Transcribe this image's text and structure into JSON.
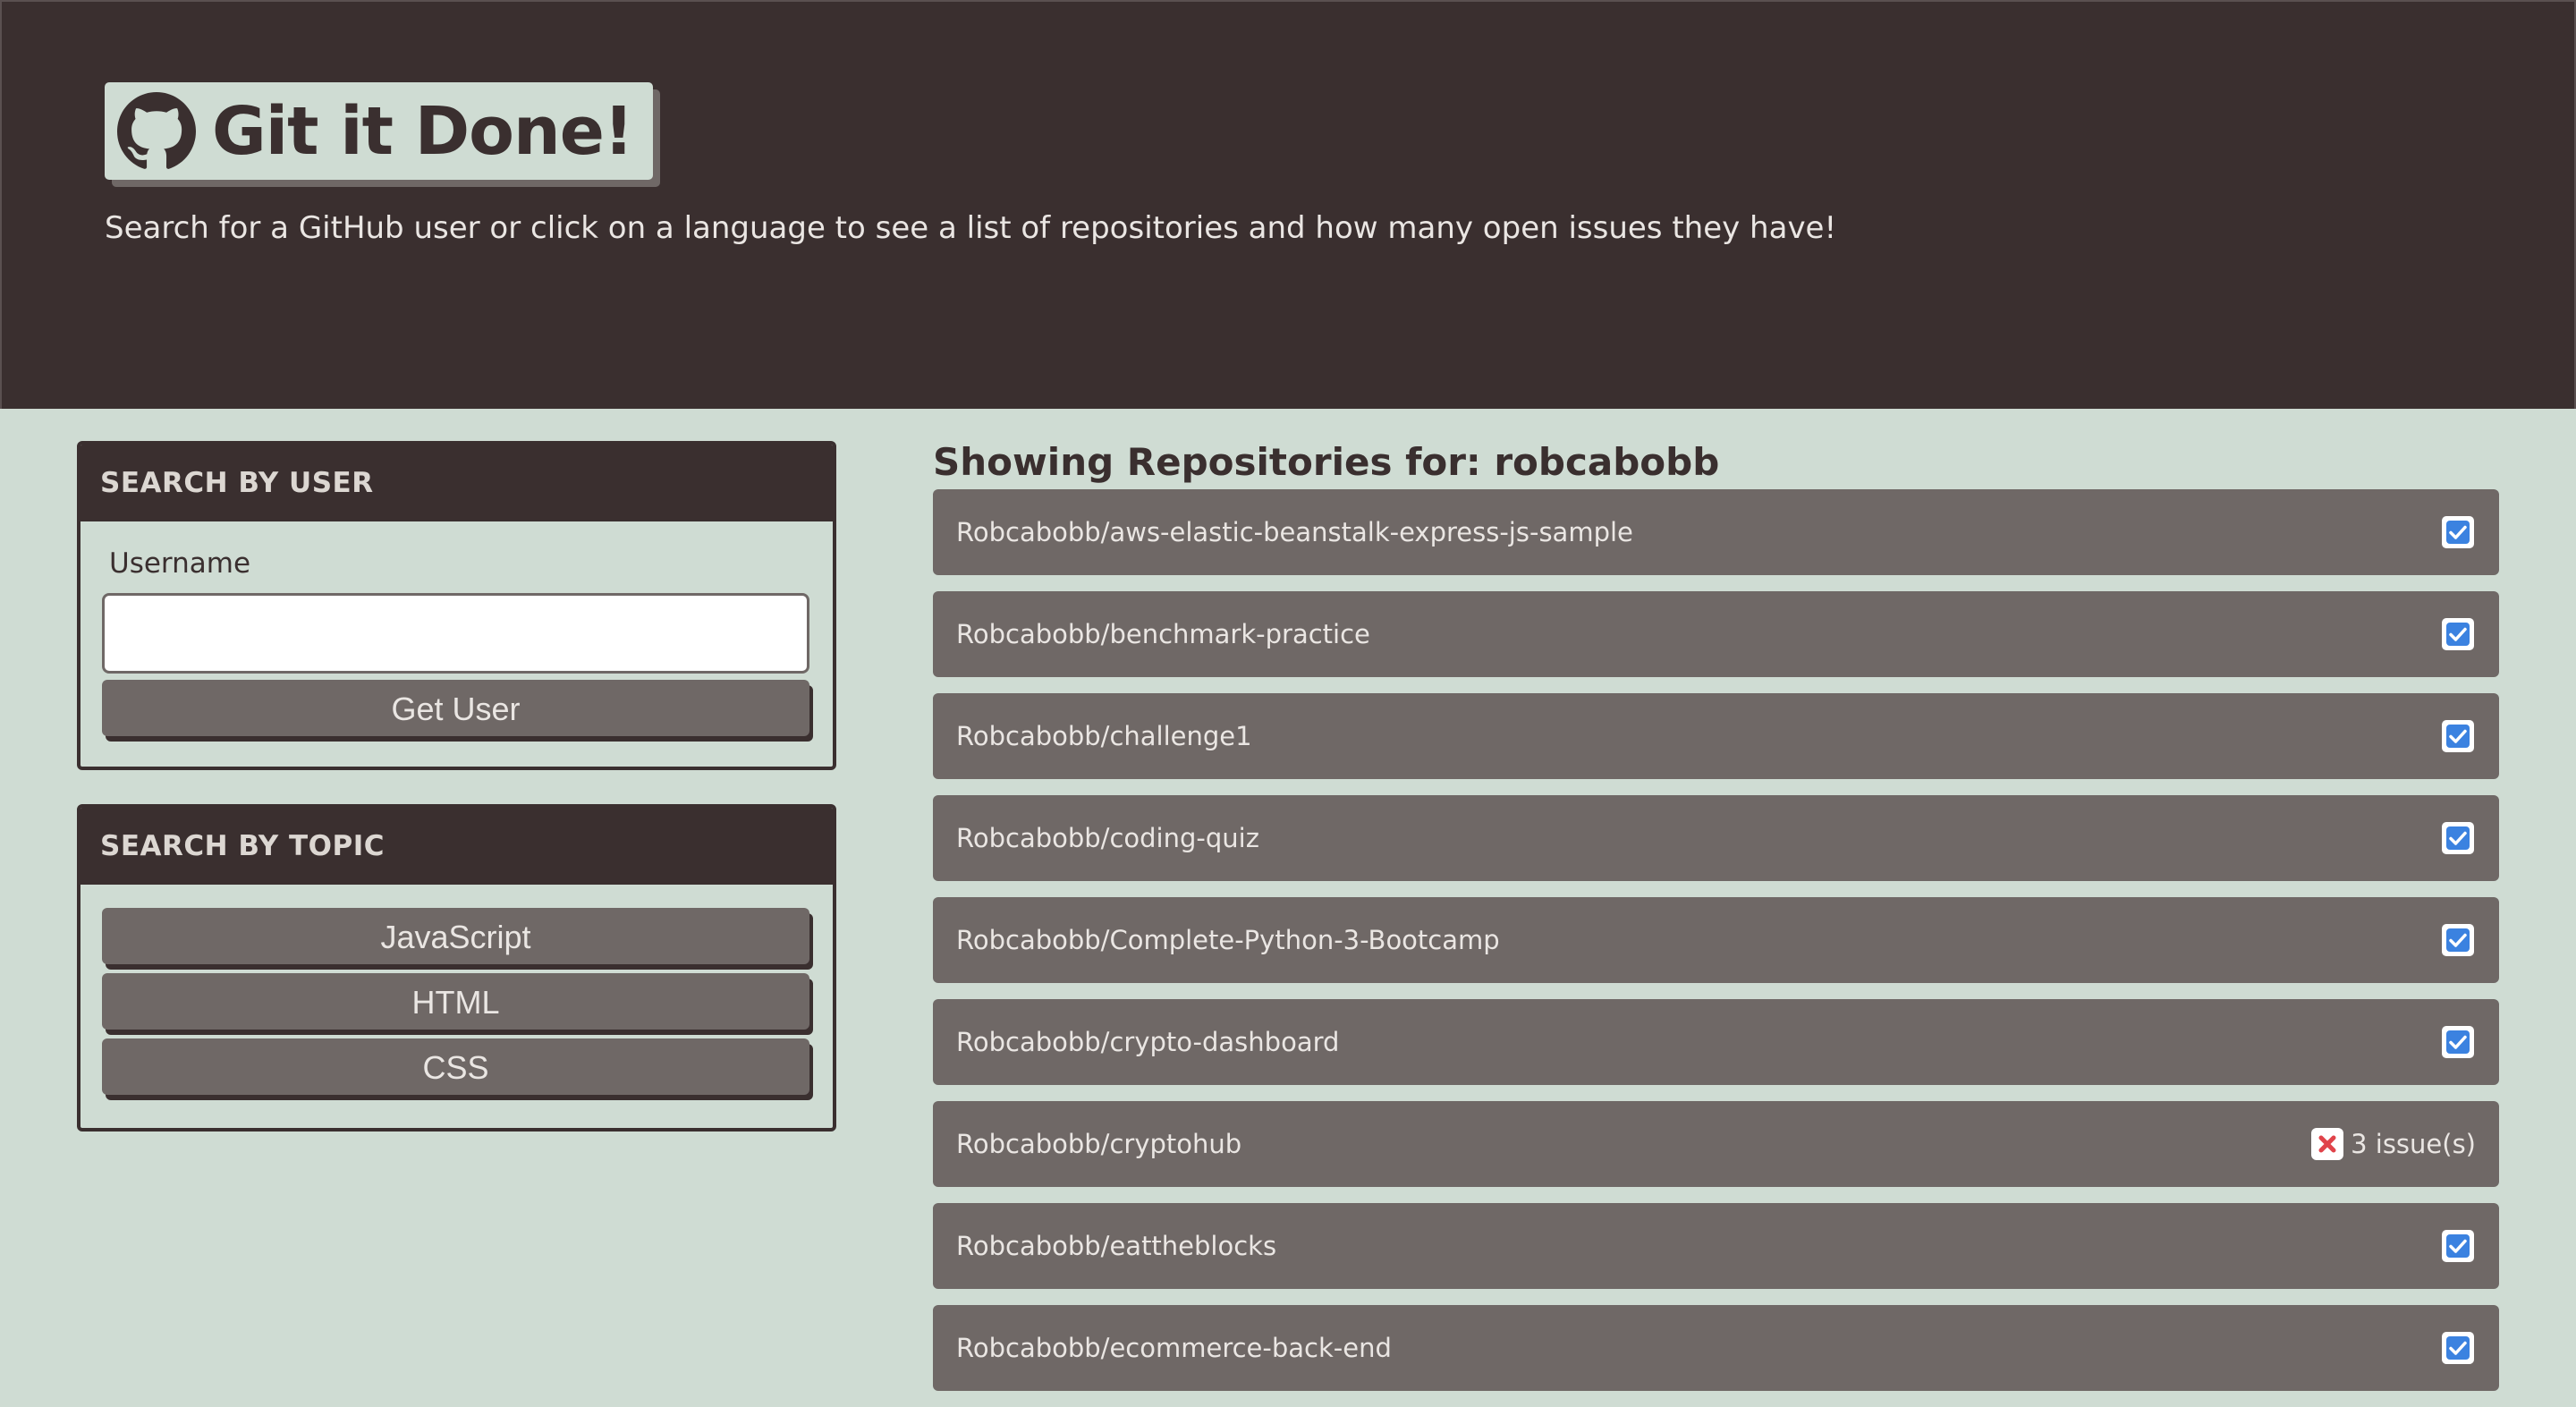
{
  "header": {
    "title": "Git it Done!",
    "logo_icon": "github-octocat-icon",
    "tagline": "Search for a GitHub user or click on a language to see a list of repositories and how many open issues they have!"
  },
  "search_user": {
    "heading": "SEARCH BY USER",
    "field_label": "Username",
    "input_value": "",
    "button_label": "Get User"
  },
  "search_topic": {
    "heading": "SEARCH BY TOPIC",
    "topics": [
      "JavaScript",
      "HTML",
      "CSS"
    ]
  },
  "repos": {
    "title": "Showing Repositories for: robcabobb",
    "items": [
      {
        "name": "Robcabobb/aws-elastic-beanstalk-express-js-sample",
        "status": "check-icon",
        "issues": ""
      },
      {
        "name": "Robcabobb/benchmark-practice",
        "status": "check-icon",
        "issues": ""
      },
      {
        "name": "Robcabobb/challenge1",
        "status": "check-icon",
        "issues": ""
      },
      {
        "name": "Robcabobb/coding-quiz",
        "status": "check-icon",
        "issues": ""
      },
      {
        "name": "Robcabobb/Complete-Python-3-Bootcamp",
        "status": "check-icon",
        "issues": ""
      },
      {
        "name": "Robcabobb/crypto-dashboard",
        "status": "check-icon",
        "issues": ""
      },
      {
        "name": "Robcabobb/cryptohub",
        "status": "x-icon",
        "issues": "3 issue(s)"
      },
      {
        "name": "Robcabobb/eattheblocks",
        "status": "check-icon",
        "issues": ""
      },
      {
        "name": "Robcabobb/ecommerce-back-end",
        "status": "check-icon",
        "issues": ""
      }
    ]
  },
  "colors": {
    "header_bg": "#3a2f2f",
    "page_bg": "#cfdcd3",
    "item_bg": "#6f6866",
    "check_blue": "#3b82e0",
    "x_red": "#e0434a"
  }
}
